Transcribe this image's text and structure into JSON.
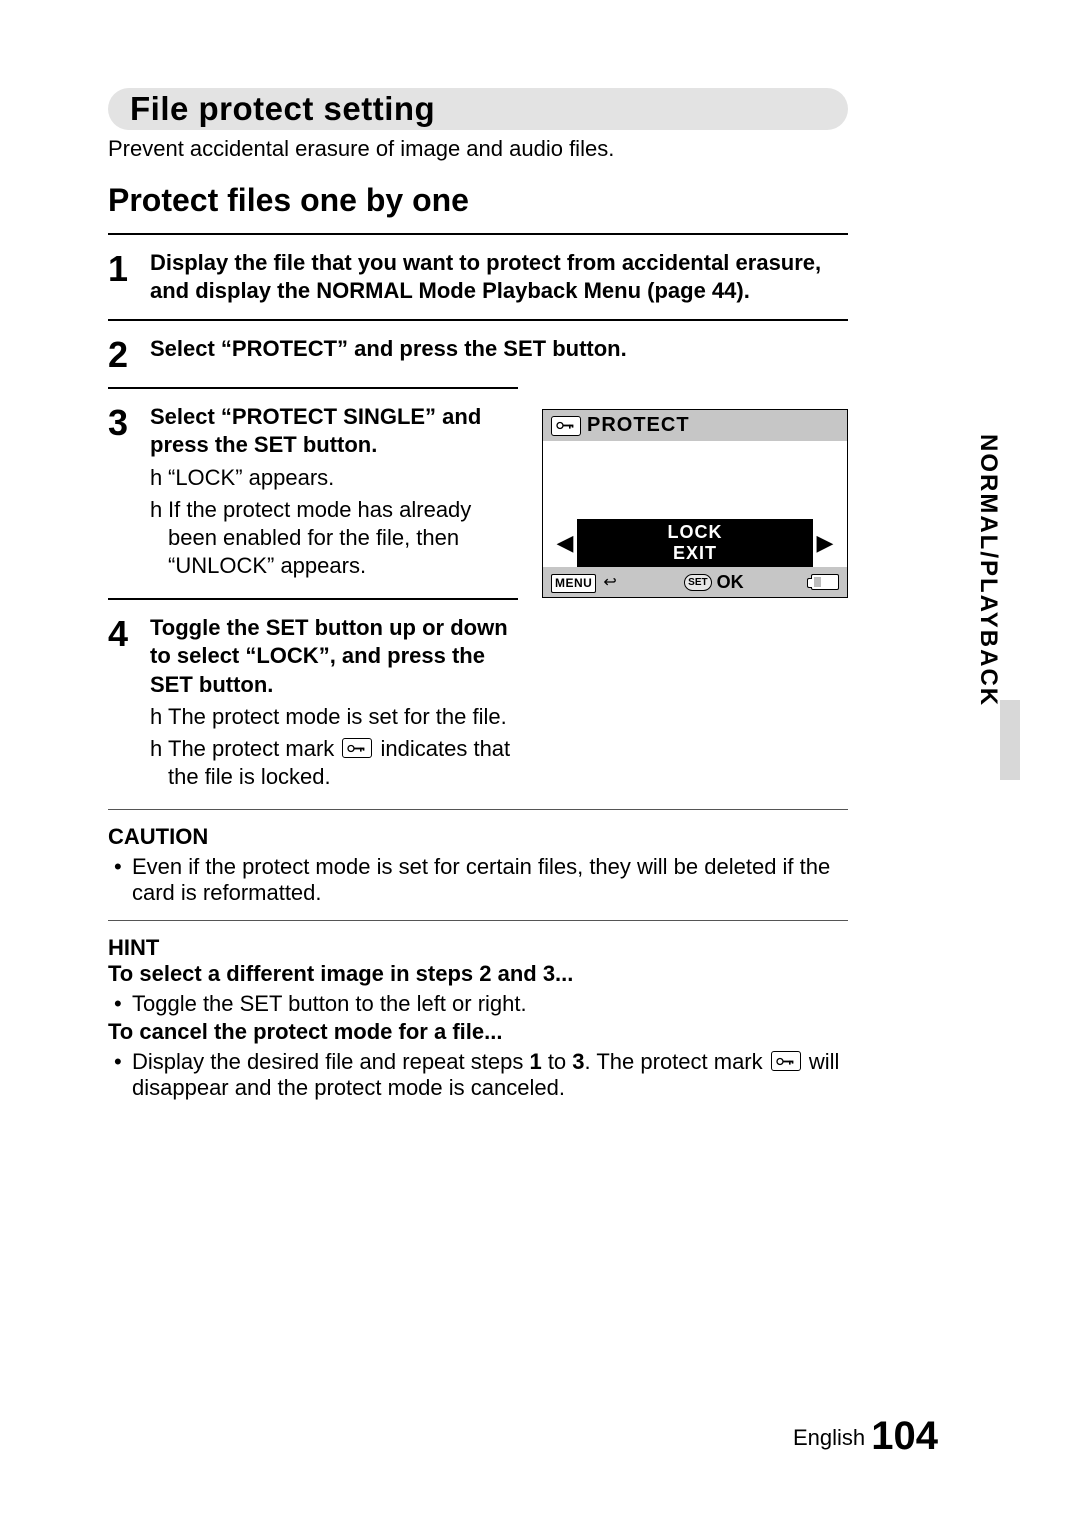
{
  "header": {
    "title": "File protect setting"
  },
  "intro": "Prevent accidental erasure of image and audio files.",
  "subhead": "Protect files one by one",
  "steps": {
    "s1": {
      "num": "1",
      "title": "Display the file that you want to protect from accidental erasure, and display the NORMAL Mode Playback Menu (page 44)."
    },
    "s2": {
      "num": "2",
      "title": "Select “PROTECT” and press the SET button."
    },
    "s3": {
      "num": "3",
      "title": "Select “PROTECT SINGLE” and press the SET button.",
      "b1": "“LOCK” appears.",
      "b2": "If the protect mode has already been enabled for the file, then “UNLOCK” appears."
    },
    "s4": {
      "num": "4",
      "title": "Toggle the SET button up or down to select “LOCK”, and press the SET button.",
      "b1": "The protect mode is set for the file.",
      "b2a": "The protect mark ",
      "b2b": " indicates that the file is locked."
    }
  },
  "screen": {
    "title": "PROTECT",
    "lock": "LOCK",
    "exit": "EXIT",
    "menu": "MENU",
    "set_badge": "SET",
    "ok": "OK"
  },
  "caution": {
    "head": "CAUTION",
    "body": "Even if the protect mode is set for certain files, they will be deleted if the card is reformatted."
  },
  "hint": {
    "head": "HINT",
    "sub1": "To select a different image in steps 2 and 3...",
    "b1": "Toggle the SET button to the left or right.",
    "sub2": "To cancel the protect mode for a file...",
    "b2a": "Display the desired file and repeat steps ",
    "b2_bold1": "1",
    "b2_mid": " to ",
    "b2_bold3": "3",
    "b2b": ". The protect mark ",
    "b2c": " will disappear and the protect mode is canceled."
  },
  "sidetab": "NORMAL/PLAYBACK",
  "footer": {
    "lang": "English",
    "page": "104"
  }
}
